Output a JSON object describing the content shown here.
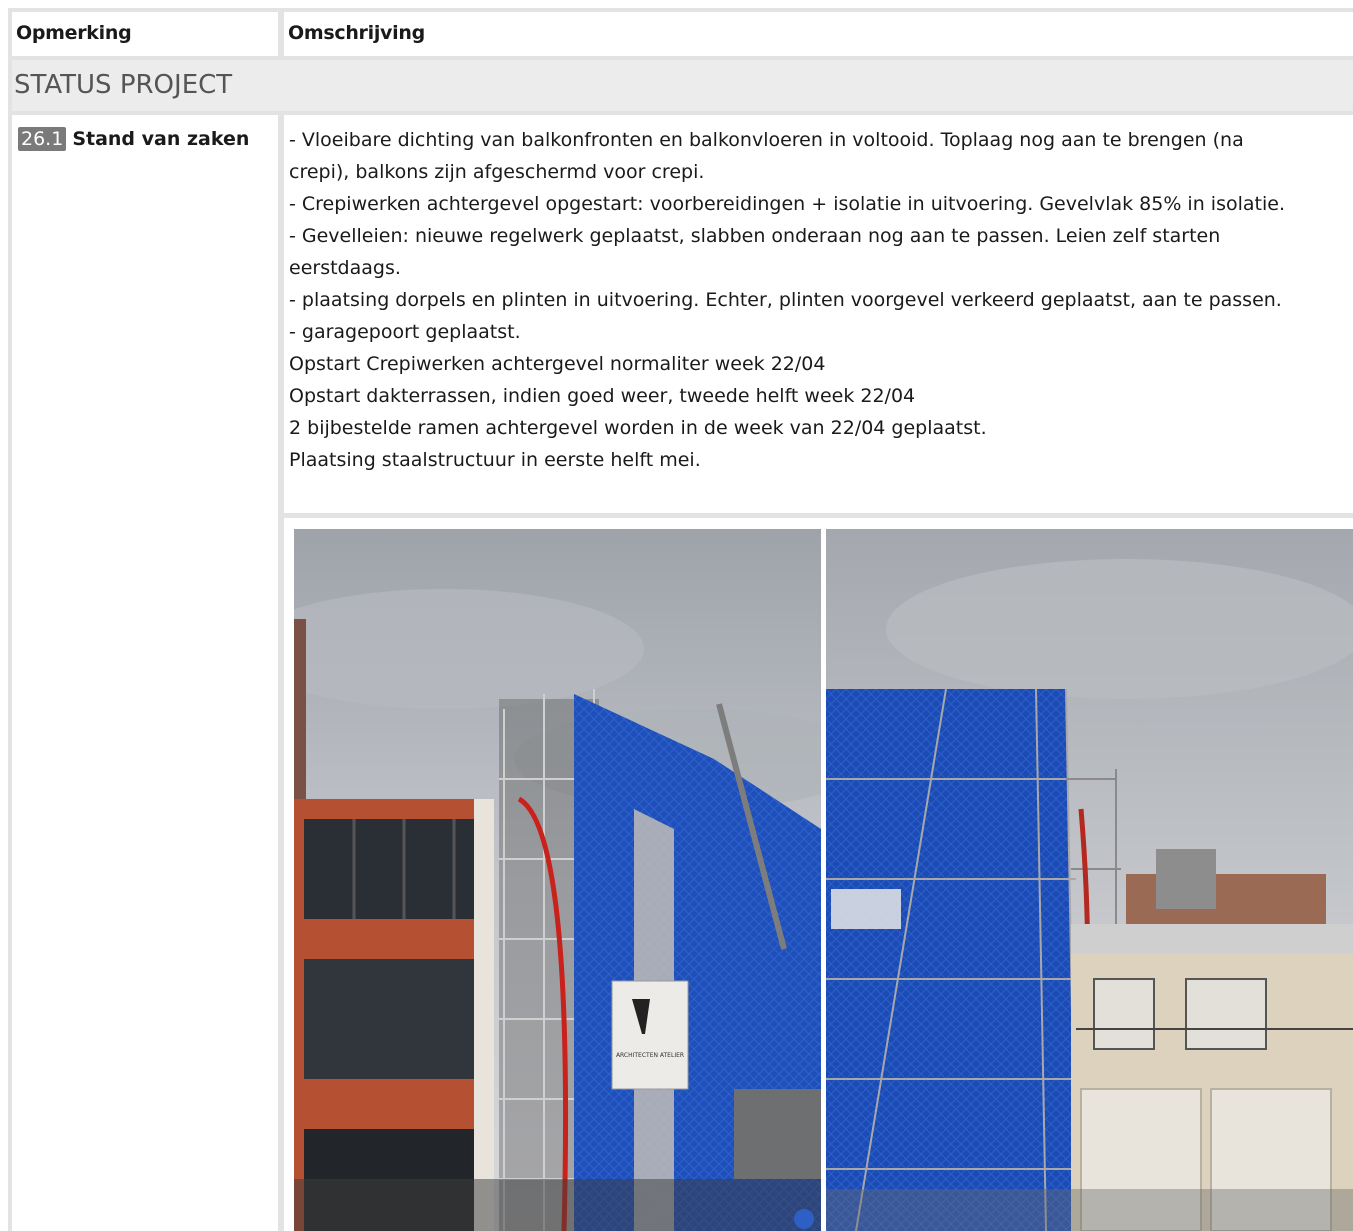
{
  "table": {
    "header": {
      "col1": "Opmerking",
      "col2": "Omschrijving"
    },
    "section_title": "STATUS PROJECT",
    "item": {
      "number": "26.1",
      "title": "Stand van zaken",
      "lines": [
        "- Vloeibare dichting van balkonfronten en balkonvloeren in voltooid. Toplaag nog aan te brengen (na",
        "crepi), balkons zijn afgeschermd voor crepi.",
        "- Crepiwerken achtergevel opgestart: voorbereidingen + isolatie in uitvoering. Gevelvlak 85% in isolatie.",
        "- Gevelleien: nieuwe regelwerk geplaatst, slabben onderaan nog aan te passen. Leien zelf starten",
        "eerstdaags.",
        "- plaatsing dorpels en plinten in uitvoering. Echter, plinten voorgevel verkeerd geplaatst, aan te passen.",
        "- garagepoort geplaatst.",
        "",
        "Opstart Crepiwerken achtergevel normaliter week 22/04",
        "Opstart dakterrassen, indien goed weer, tweede helft week 22/04",
        "2 bijbestelde ramen achtergevel worden in de week van 22/04 geplaatst.",
        "Plaatsing staalstructuur in eerste helft mei."
      ]
    },
    "photos": [
      {
        "banner_text": "ARCHITECTEN ATELIER"
      },
      {
        "banner_text": ""
      }
    ]
  }
}
